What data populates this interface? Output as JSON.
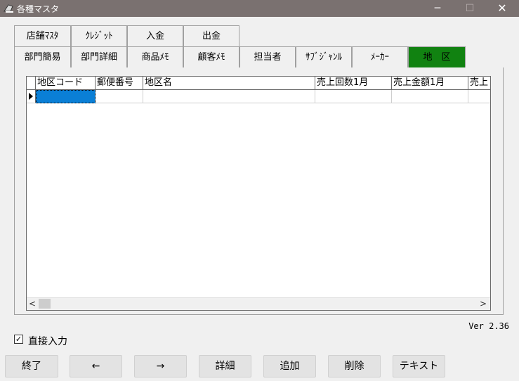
{
  "window": {
    "title": "各種マスタ",
    "minimize_glyph": "─",
    "maximize_glyph": "☐",
    "close_glyph": "✕"
  },
  "tabs_row1": [
    "店舗ﾏｽﾀ",
    "ｸﾚｼﾞｯﾄ",
    "入金",
    "出金"
  ],
  "tabs_row2": [
    "部門簡易",
    "部門詳細",
    "商品ﾒﾓ",
    "顧客ﾒﾓ",
    "担当者",
    "ｻﾌﾞｼﾞｬﾝﾙ",
    "ﾒｰｶｰ",
    "地　区"
  ],
  "active_tab": "地　区",
  "grid": {
    "columns": [
      "地区コード",
      "郵便番号",
      "地区名",
      "売上回数1月",
      "売上金額1月",
      "売上"
    ],
    "scroll_left": "<",
    "scroll_right": ">"
  },
  "version": "Ver 2.36",
  "direct_input": {
    "label": "直接入力",
    "checked": true,
    "mark": "✓"
  },
  "buttons": {
    "end": "終了",
    "prev": "←",
    "next": "→",
    "detail": "詳細",
    "add": "追加",
    "delete": "削除",
    "text": "テキスト"
  },
  "icons": {
    "app": "app-icon",
    "arrow": "row-pointer-icon"
  },
  "colors": {
    "titlebar": "#7a7170",
    "active_tab": "#118211",
    "selection": "#0a7fd6"
  }
}
